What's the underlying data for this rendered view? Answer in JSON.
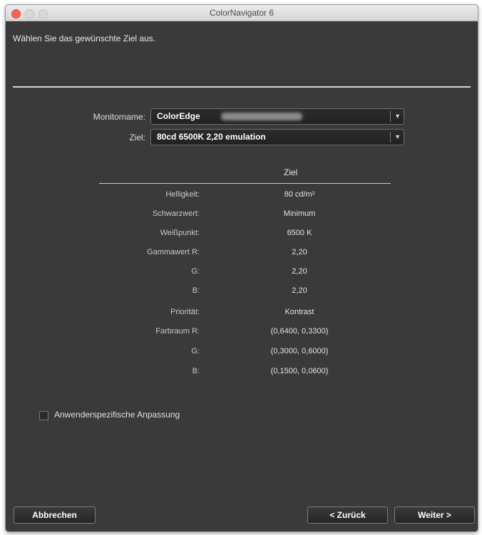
{
  "window": {
    "title": "ColorNavigator 6"
  },
  "instruction": "Wählen Sie das gewünschte Ziel aus.",
  "form": {
    "monitor_label": "Monitorname:",
    "monitor_value": "ColorEdge",
    "target_label": "Ziel:",
    "target_value": "80cd 6500K 2,20 emulation"
  },
  "table": {
    "header": "Ziel",
    "rows": [
      {
        "label": "Helligkeit:",
        "value": "80 cd/m²"
      },
      {
        "label": "Schwarzwert:",
        "value": "Minimum"
      },
      {
        "label": "Weißpunkt:",
        "value": "6500 K"
      },
      {
        "label": "Gammawert R:",
        "value": "2,20"
      },
      {
        "label": "G:",
        "value": "2,20"
      },
      {
        "label": "B:",
        "value": "2,20"
      },
      {
        "label": "Priorität:",
        "value": "Kontrast"
      },
      {
        "label": "Farbraum R:",
        "value": "(0,6400, 0,3300)"
      },
      {
        "label": "G:",
        "value": "(0,3000, 0,6000)"
      },
      {
        "label": "B:",
        "value": "(0,1500, 0,0600)"
      }
    ]
  },
  "custom_adjust_label": "Anwenderspezifische Anpassung",
  "buttons": {
    "cancel": "Abbrechen",
    "back": "< Zurück",
    "next": "Weiter >"
  },
  "icons": {
    "dropdown": "chevron-down-icon"
  }
}
